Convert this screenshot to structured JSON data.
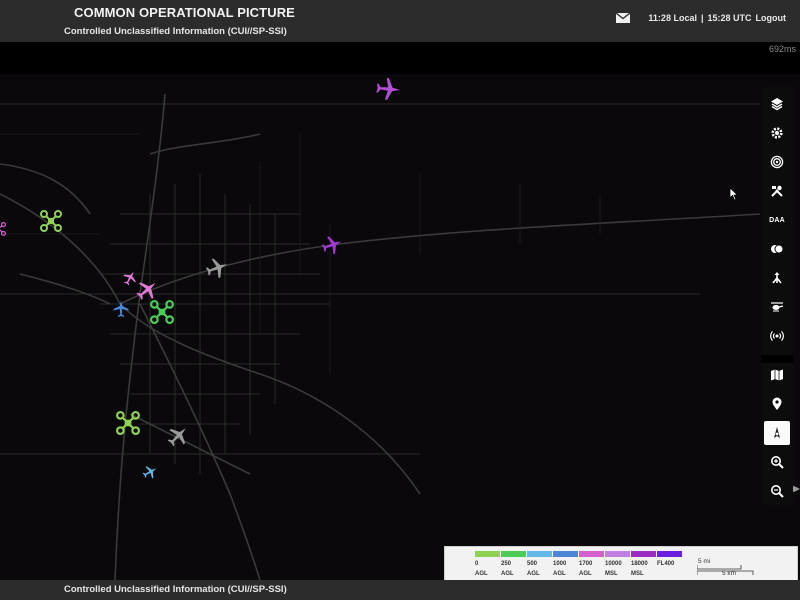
{
  "header": {
    "title": "COMMON OPERATIONAL PICTURE",
    "classification": "Controlled Unclassified Information (CUI//SP-SSI)",
    "local_time": "11:28 Local",
    "separator": "|",
    "utc_time": "15:28 UTC",
    "logout_label": "Logout"
  },
  "status": {
    "latency": "692ms"
  },
  "toolbar": {
    "icons": [
      "layers-icon",
      "settings-icon",
      "radar-icon",
      "tools-icon",
      "daa-icon",
      "overlap-icon",
      "merge-icon",
      "helicopter-icon",
      "broadcast-icon",
      "map-icon",
      "location-pin-icon",
      "compass-icon",
      "zoom-in-icon",
      "zoom-out-icon"
    ],
    "daa_label": "DAA",
    "active": "compass-icon"
  },
  "legend": {
    "bands": [
      {
        "value": "0",
        "unit": "AGL",
        "color": "#8fd155"
      },
      {
        "value": "250",
        "unit": "AGL",
        "color": "#4ccc57"
      },
      {
        "value": "500",
        "unit": "AGL",
        "color": "#63b8e8"
      },
      {
        "value": "1000",
        "unit": "AGL",
        "color": "#4c86d6"
      },
      {
        "value": "1700",
        "unit": "AGL",
        "color": "#d45fcf"
      },
      {
        "value": "10000",
        "unit": "MSL",
        "color": "#c27ee0"
      },
      {
        "value": "18000",
        "unit": "MSL",
        "color": "#9b2bc3"
      },
      {
        "value": "FL400",
        "unit": "",
        "color": "#6a1ee0"
      }
    ],
    "scale_mi": "5 mi",
    "scale_km": "5 km"
  },
  "footer": {
    "classification": "Controlled Unclassified Information (CUI//SP-SSI)"
  },
  "aircraft": [
    {
      "name": "aircraft-purple-north",
      "color": "#b24fd6"
    },
    {
      "name": "aircraft-purple-east",
      "color": "#a43ad2"
    },
    {
      "name": "aircraft-gray-center",
      "color": "#9a9a9a"
    },
    {
      "name": "aircraft-pink-1",
      "color": "#e07ad6"
    },
    {
      "name": "aircraft-pink-2",
      "color": "#e07ad6"
    },
    {
      "name": "aircraft-blue-1",
      "color": "#4c86d6"
    },
    {
      "name": "aircraft-gray-south",
      "color": "#9a9a9a"
    },
    {
      "name": "aircraft-lightblue-south",
      "color": "#63b8e8"
    }
  ]
}
